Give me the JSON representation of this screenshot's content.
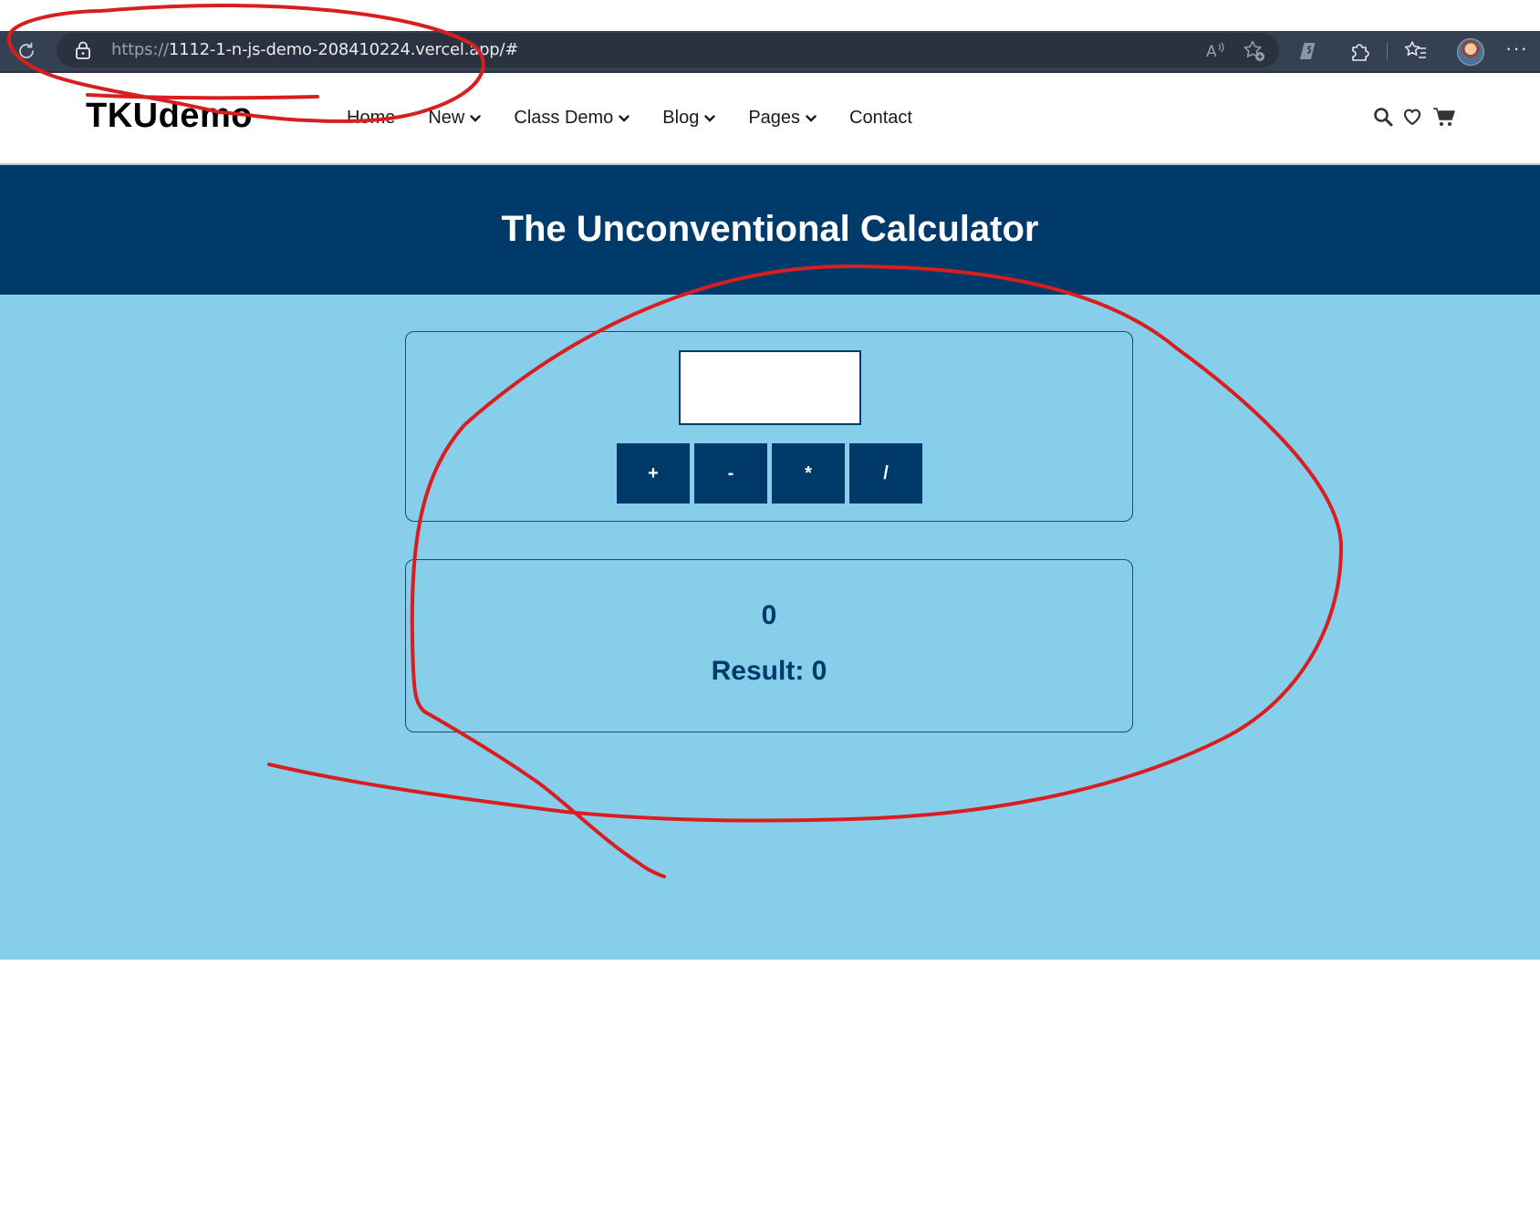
{
  "browser": {
    "url_protocol": "https://",
    "url_rest": "1112-1-n-js-demo-208410224.vercel.app/#",
    "icons": [
      "refresh-icon",
      "lock-icon",
      "read-aloud-icon",
      "add-favorite-icon",
      "extension-icon",
      "puzzle-icon",
      "favorites-icon",
      "profile-avatar",
      "more-icon"
    ],
    "more_label": "···"
  },
  "header": {
    "logo": "TKUdemo",
    "nav": [
      {
        "label": "Home",
        "dropdown": false
      },
      {
        "label": "New",
        "dropdown": true
      },
      {
        "label": "Class Demo",
        "dropdown": true
      },
      {
        "label": "Blog",
        "dropdown": true
      },
      {
        "label": "Pages",
        "dropdown": true
      },
      {
        "label": "Contact",
        "dropdown": false
      }
    ],
    "icons": [
      "search-icon",
      "heart-icon",
      "cart-icon"
    ]
  },
  "hero": {
    "title": "The Unconventional Calculator"
  },
  "calculator": {
    "input_value": "",
    "operators": [
      "+",
      "-",
      "*",
      "/"
    ],
    "display_value": "0",
    "result_label": "Result:",
    "result_value": "0"
  },
  "colors": {
    "browser_bar": "#354052",
    "primary": "#003a6b",
    "content_bg": "#87ceea",
    "annotation": "#d81e1e"
  }
}
